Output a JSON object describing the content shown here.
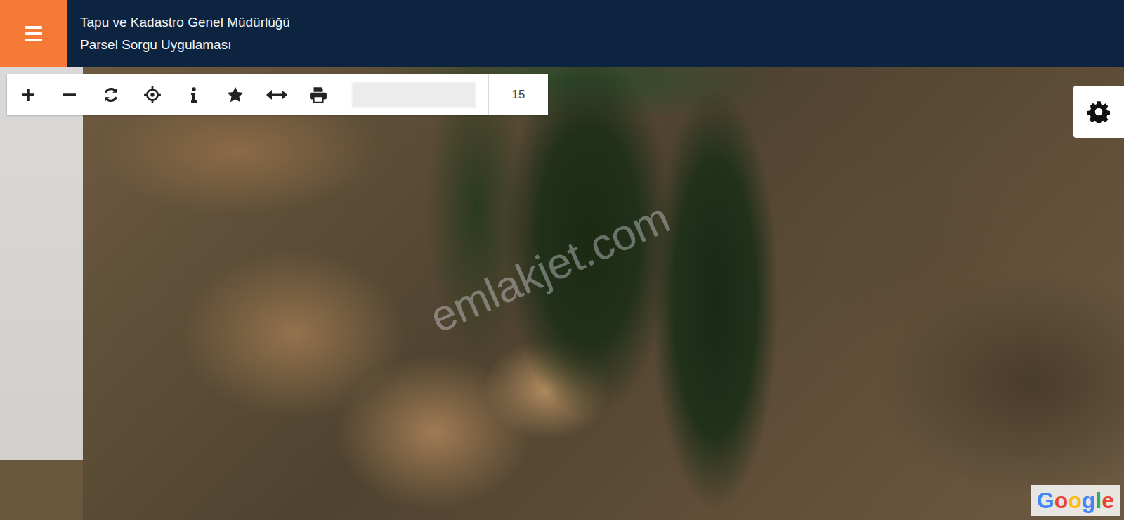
{
  "header": {
    "title": "Tapu ve Kadastro Genel Müdürlüğü",
    "subtitle": "Parsel Sorgu Uygulaması"
  },
  "toolbar": {
    "tools": [
      {
        "kind": "zoom-in"
      },
      {
        "kind": "zoom-out"
      },
      {
        "kind": "refresh"
      },
      {
        "kind": "locate"
      },
      {
        "kind": "info"
      },
      {
        "kind": "favorite"
      },
      {
        "kind": "measure"
      },
      {
        "kind": "print"
      }
    ],
    "search": {
      "value": ""
    },
    "zoom_level": "15"
  },
  "map": {
    "watermark": "emlakjet.com",
    "attribution": "Google"
  }
}
